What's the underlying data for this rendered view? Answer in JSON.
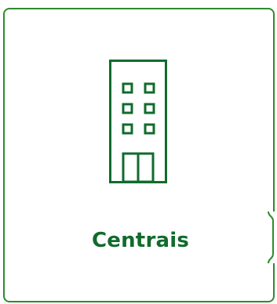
{
  "card": {
    "label": "Centrais",
    "icon": "building-icon",
    "border_color": "#2e8b2e",
    "icon_color": "#116b2c",
    "text_color": "#116b2c"
  }
}
